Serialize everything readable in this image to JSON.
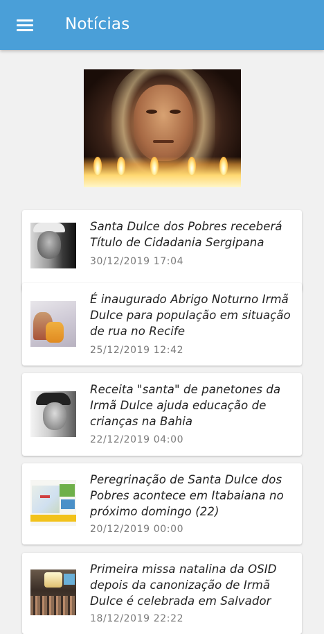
{
  "app_bar": {
    "title": "Notícias",
    "menu_icon": "hamburger-menu-icon",
    "color": "#4a9fd8"
  },
  "news": [
    {
      "title": "Santa Dulce dos Pobres receberá Título de Cidadania Sergipana",
      "date": "30/12/2019 17:04"
    },
    {
      "title": "É inaugurado Abrigo Noturno Irmã Dulce para população em situação de rua no Recife",
      "date": "25/12/2019 12:42"
    },
    {
      "title": "Receita \"santa\" de panetones da Irmã Dulce ajuda educação de crianças na Bahia",
      "date": "22/12/2019 04:00"
    },
    {
      "title": "Peregrinação de Santa Dulce dos Pobres acontece em Itabaiana no próximo domingo (22)",
      "date": "20/12/2019 00:00"
    },
    {
      "title": "Primeira missa natalina da OSID depois da canonização de Irmã Dulce é celebrada em Salvador",
      "date": "18/12/2019 22:22"
    }
  ]
}
